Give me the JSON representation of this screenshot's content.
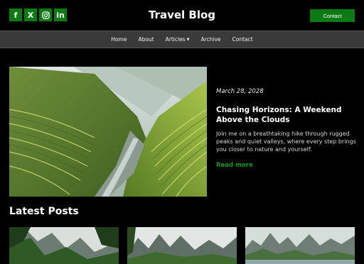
{
  "header": {
    "brand": "Travel Blog",
    "contact_label": "Contact",
    "social": [
      {
        "icon": "facebook-icon",
        "glyph": "f"
      },
      {
        "icon": "x-twitter-icon",
        "glyph": "X"
      },
      {
        "icon": "instagram-icon"
      },
      {
        "icon": "linkedin-icon",
        "glyph": "in"
      }
    ]
  },
  "nav": {
    "items": [
      "Home",
      "About",
      "Articles",
      "Archive",
      "Contact"
    ]
  },
  "hero": {
    "date": "March 28, 2028",
    "title": "Chasing Horizons: A Weekend Above the Clouds",
    "description": "Join me on a breathtaking hike through rugged peaks and quiet valleys, where every step brings you closer to nature and yourself.",
    "read_more": "Read more"
  },
  "latest": {
    "heading": "Latest Posts"
  },
  "colors": {
    "accent": "#0a7a12",
    "link": "#0a9a1a",
    "nav_bg": "#3a3a3a",
    "page_bg": "#000000"
  }
}
